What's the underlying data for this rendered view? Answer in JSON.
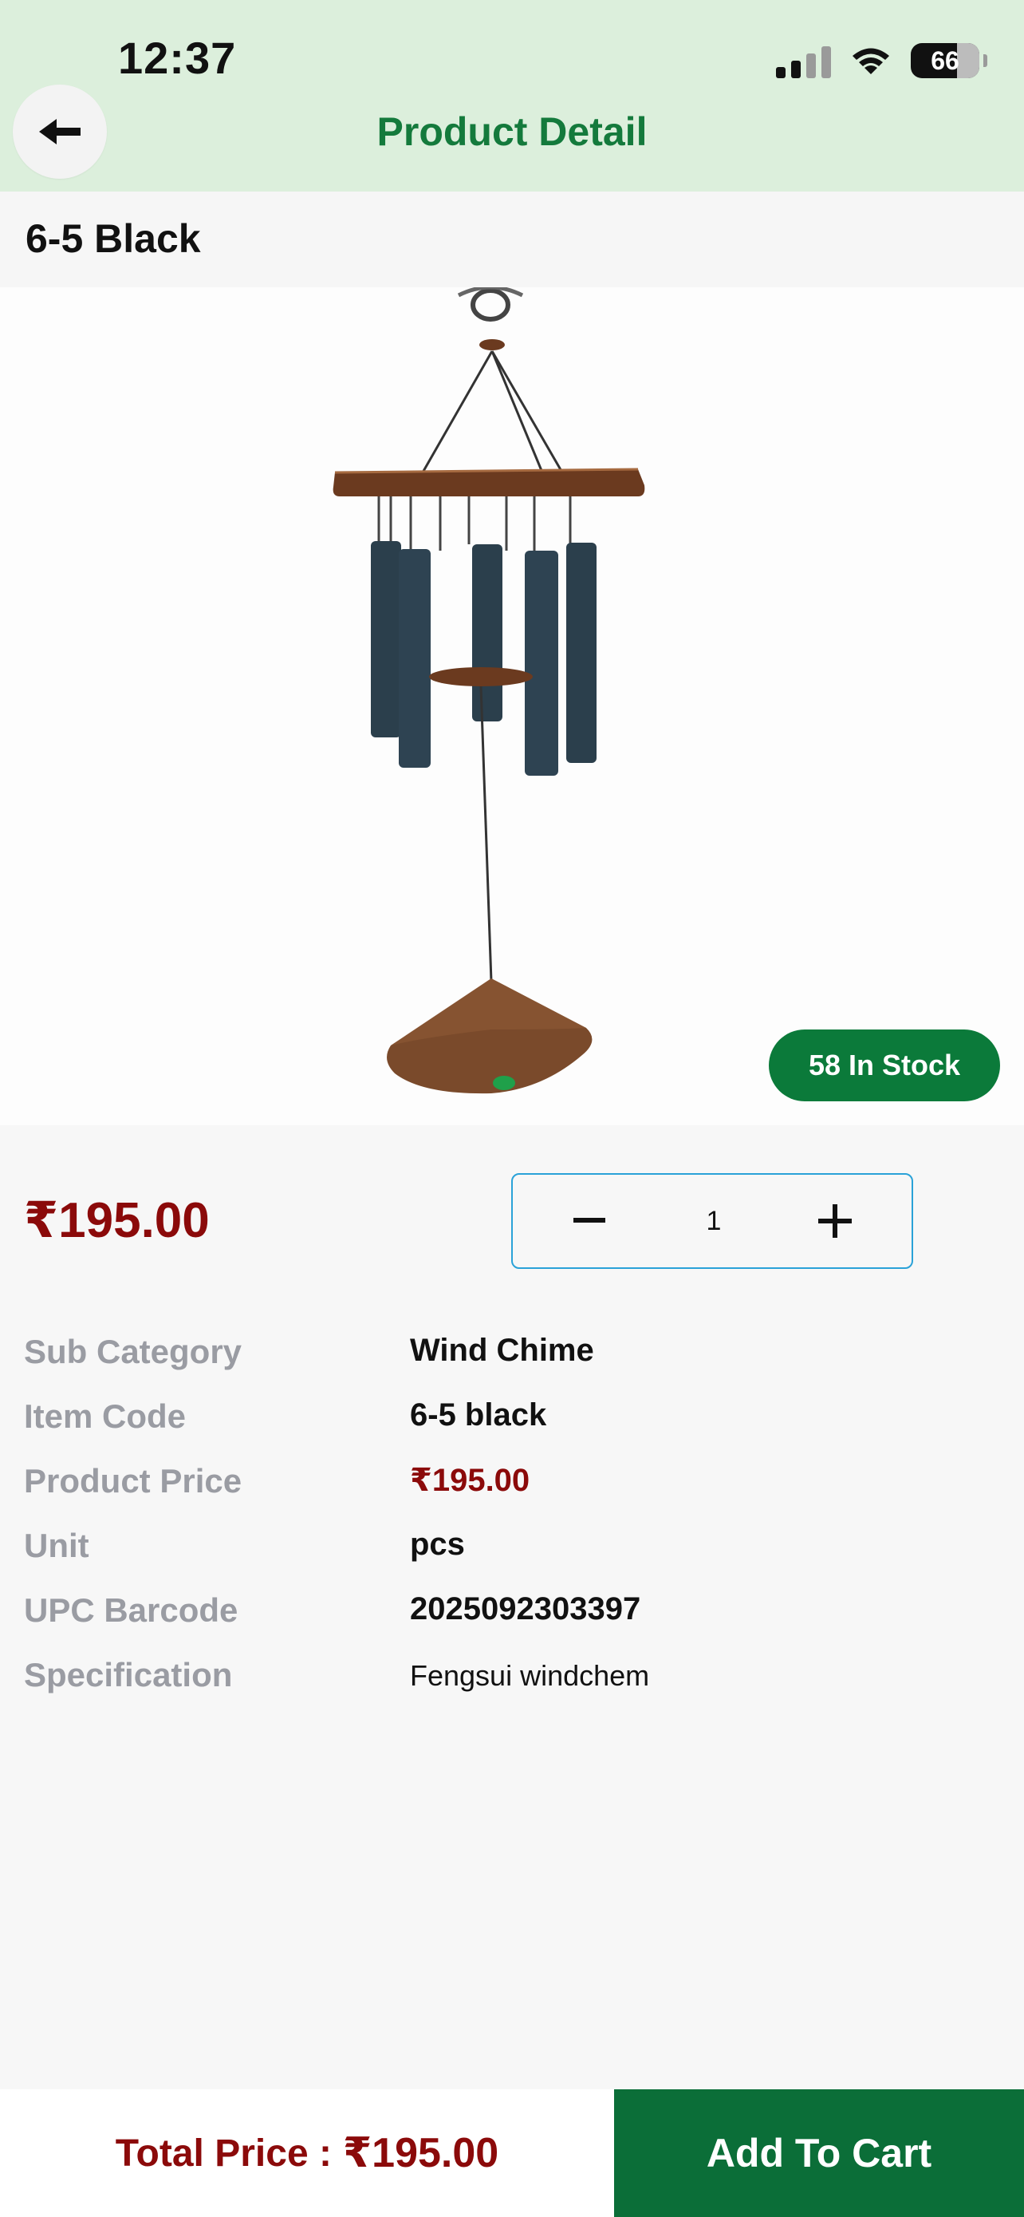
{
  "status_bar": {
    "time": "12:37",
    "battery": "66"
  },
  "header": {
    "title": "Product Detail",
    "back_icon": "arrow-left-icon"
  },
  "product": {
    "name": "6-5 Black",
    "stock_badge": "58 In Stock",
    "price": "₹195.00",
    "quantity": "1"
  },
  "details": [
    {
      "label": "Sub Category",
      "value": "Wind Chime"
    },
    {
      "label": "Item Code",
      "value": "6-5 black"
    },
    {
      "label": "Product Price",
      "value": "₹195.00"
    },
    {
      "label": "Unit",
      "value": "pcs"
    },
    {
      "label": "UPC Barcode",
      "value": "2025092303397"
    },
    {
      "label": "Specification",
      "value": "Fengsui windchem"
    }
  ],
  "footer": {
    "total_label": "Total Price :",
    "total_amount": "₹195.00",
    "add_to_cart": "Add To Cart"
  },
  "colors": {
    "header_bg": "#dcefdc",
    "brand_green": "#0b6e38",
    "price_red": "#8b0a0a",
    "qty_border": "#2aa2d8"
  }
}
